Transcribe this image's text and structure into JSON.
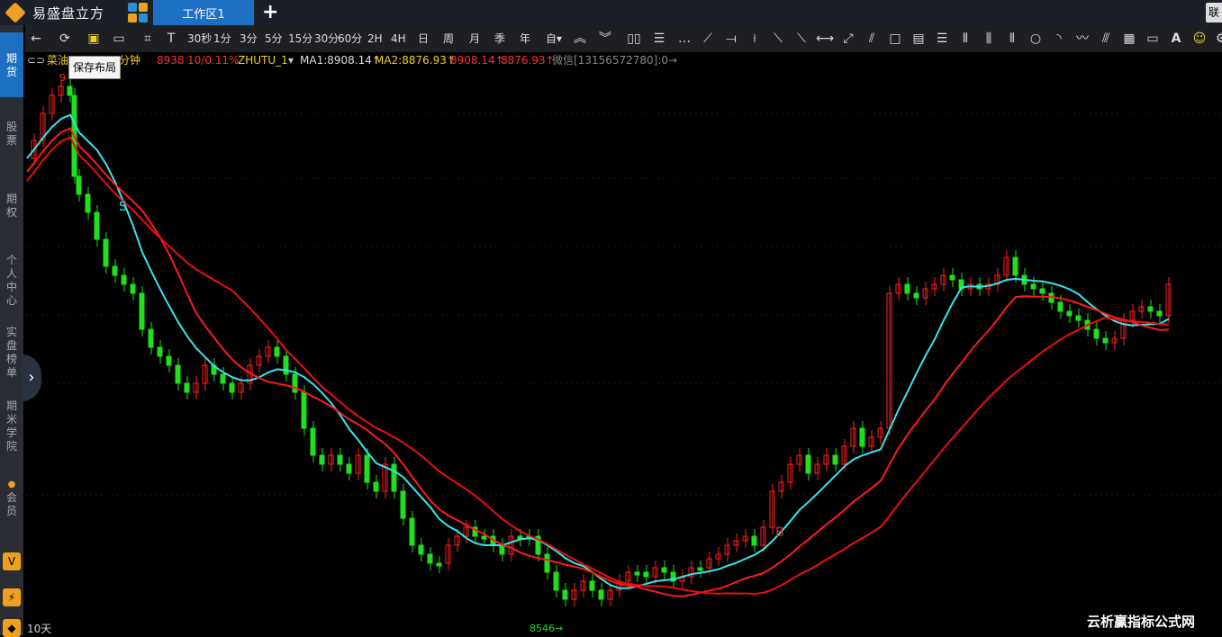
{
  "app": {
    "title": "易盛盘立方",
    "tab": "工作区1",
    "connect_label": "联"
  },
  "toolbar": {
    "periods": [
      "30秒",
      "1分",
      "3分",
      "5分",
      "15分",
      "30分",
      "60分",
      "2H",
      "4H",
      "日",
      "周",
      "月",
      "季",
      "年",
      "自▾"
    ],
    "tooltip": "保存布局"
  },
  "infobar": {
    "name": "菜油",
    "period": "分钟",
    "price": "8938",
    "change": "10/0.11%",
    "indicator": "ZHUTU_1",
    "ma1": "MA1:8908.14↑",
    "ma2": "MA2:8876.93↑",
    "v1": "8908.14↑",
    "v2": "8876.93↑",
    "wechat": "微信[13156572780]:0→"
  },
  "sidebar": {
    "items": [
      "期货",
      "股票",
      "期权",
      "个人中心",
      "实盘榜单",
      "期米学院",
      "会员"
    ]
  },
  "chart": {
    "high_label": "9",
    "low_label": "8546→",
    "sell_marker": "S",
    "buy_marker": "B",
    "period_label": "10天"
  },
  "watermark": "云析赢指标公式网",
  "chart_data": {
    "type": "candlestick",
    "colors": {
      "up": "#ff2020",
      "down": "#1ee01e",
      "ma_short": "#33e6ef",
      "ma_long": "#ff1a1a",
      "ma_long2": "#e81010"
    }
  }
}
